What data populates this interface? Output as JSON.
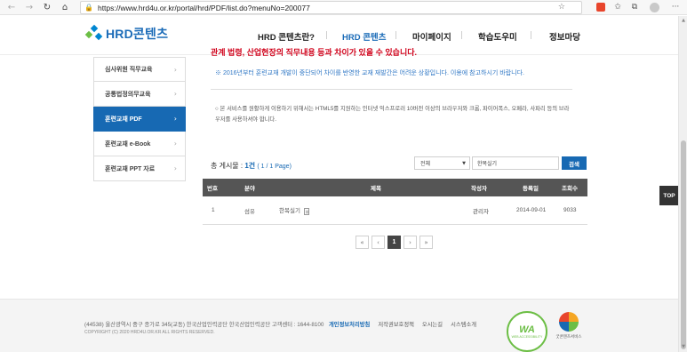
{
  "browser": {
    "url": "https://www.hrd4u.or.kr/portal/hrd/PDF/list.do?menuNo=200077",
    "back_icon": "←",
    "forward_icon": "→",
    "reload_icon": "↻",
    "home_icon": "⌂",
    "lock_icon": "🔒",
    "star_icon": "☆",
    "menu_icon": "···"
  },
  "header": {
    "logo_text": "HRD콘텐츠",
    "nav": [
      "HRD 콘텐츠란?",
      "HRD 콘텐츠",
      "마이페이지",
      "학습도우미",
      "정보마당"
    ],
    "active_index": 1
  },
  "notices": {
    "red": "관계 법령, 산업현장의 직무내용 등과 차이가 있을 수 있습니다.",
    "blue": "※ 2016년부터 훈련교재 개발이 중단되어 차이를 반영한 교재 재발간은 어려운 상황입니다. 이용에 참고하시기 바랍니다.",
    "service": "○ 본 서비스를 원활하게 이용하기 위해서는 HTML5를 지원하는 인터넷 익스프로러 10버전 이상의 브라우저와 크롬, 파이어폭스, 오페라, 사파리 등의 브라우저를 사용하셔야 합니다."
  },
  "side_menu": {
    "items": [
      {
        "label": "심사위원 직무교육",
        "active": false
      },
      {
        "label": "공통법정의무교육",
        "active": false
      },
      {
        "label": "훈련교재 PDF",
        "active": true
      },
      {
        "label": "훈련교재 e-Book",
        "active": false
      },
      {
        "label": "훈련교재 PPT 자료",
        "active": false
      }
    ],
    "chevron": "›"
  },
  "search": {
    "total_label": "총 게시물 : ",
    "total_count": "1건",
    "page_info": "( 1 / 1 Page)",
    "select_value": "전체",
    "input_value": "한복실기",
    "button_label": "검색"
  },
  "table": {
    "columns": [
      "번호",
      "분야",
      "제목",
      "작성자",
      "등록일",
      "조회수"
    ],
    "rows": [
      {
        "no": "1",
        "field": "섬유",
        "title": "한복실기",
        "author": "관리자",
        "date": "2014-09-01",
        "views": "9033"
      }
    ]
  },
  "pagination": {
    "first": "«",
    "prev": "‹",
    "current": "1",
    "next": "›",
    "last": "»"
  },
  "top_button": "TOP",
  "footer": {
    "address": "(44538) 울산광역시 중구 종가로 345(교동) 한국산업인력공단 한국산업인력공단 고객센터 : 1644-8100",
    "links": [
      "개인정보처리방침",
      "저작권보호정책",
      "오시는길",
      "시스템소개"
    ],
    "copyright": "COPYRIGHT (C) 2020 HRD4U.OR.KR ALL RIGHTS RESERVED.",
    "wa_label": "WA",
    "wa_sub": "WEB ACCESSIBILITY",
    "gc_label": "굿콘텐츠서비스"
  },
  "colors": {
    "brand": "#1769b3",
    "notice_red": "#d0021b",
    "notice_blue": "#2f77c5",
    "table_header": "#555555"
  }
}
